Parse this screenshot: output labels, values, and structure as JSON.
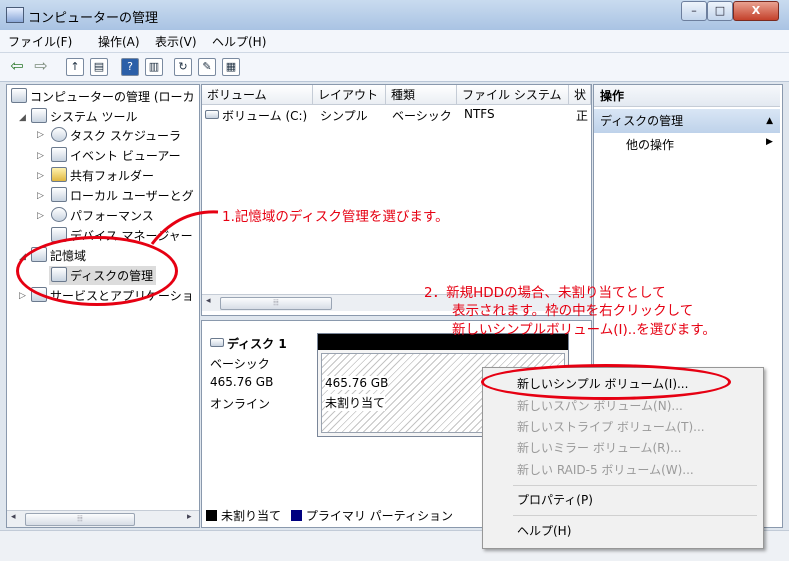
{
  "window": {
    "title": "コンピューターの管理",
    "min_label": "–",
    "max_label": "□",
    "close_label": "X"
  },
  "menu": [
    "ファイル(F)",
    "操作(A)",
    "表示(V)",
    "ヘルプ(H)"
  ],
  "tree": {
    "root": "コンピューターの管理 (ローカ",
    "system_tools": "システム ツール",
    "task_scheduler": "タスク スケジューラ",
    "event_viewer": "イベント ビューアー",
    "shared_folders": "共有フォルダー",
    "local_users": "ローカル ユーザーとグ",
    "performance": "パフォーマンス",
    "device_manager": "デバイス マネージャー",
    "storage": "記憶域",
    "disk_management": "ディスクの管理",
    "services": "サービスとアプリケーショ"
  },
  "volume_list": {
    "columns": [
      "ボリューム",
      "レイアウト",
      "種類",
      "ファイル システム",
      "状"
    ],
    "rows": [
      [
        "ボリューム (C:)",
        "シンプル",
        "ベーシック",
        "NTFS",
        "正"
      ]
    ]
  },
  "disk": {
    "name": "ディスク 1",
    "type": "ベーシック",
    "size": "465.76 GB",
    "status": "オンライン",
    "partition_size": "465.76 GB",
    "partition_status": "未割り当て"
  },
  "legend": {
    "unallocated": "未割り当て",
    "primary": "プライマリ パーティション",
    "unallocated_color": "#000000",
    "primary_color": "#000080"
  },
  "actions": {
    "header": "操作",
    "selected": "ディスクの管理",
    "other": "他の操作"
  },
  "context_menu": [
    {
      "label": "新しいシンプル ボリューム(I)...",
      "enabled": true
    },
    {
      "label": "新しいスパン ボリューム(N)...",
      "enabled": false
    },
    {
      "label": "新しいストライプ ボリューム(T)...",
      "enabled": false
    },
    {
      "label": "新しいミラー ボリューム(R)...",
      "enabled": false
    },
    {
      "label": "新しい RAID-5 ボリューム(W)...",
      "enabled": false
    },
    {
      "label": "プロパティ(P)",
      "enabled": true
    },
    {
      "label": "ヘルプ(H)",
      "enabled": true
    }
  ],
  "annotations": {
    "step1": "1.記憶域のディスク管理を選びます。",
    "step2_line1": "2．新規HDDの場合、未割り当てとして",
    "step2_line2": "表示されます。枠の中を右クリックして",
    "step2_line3": "新しいシンプルボリューム(I)..を選びます。"
  },
  "colors": {
    "annotation_red": "#e60012",
    "selection_blue": "#bed2ea"
  }
}
